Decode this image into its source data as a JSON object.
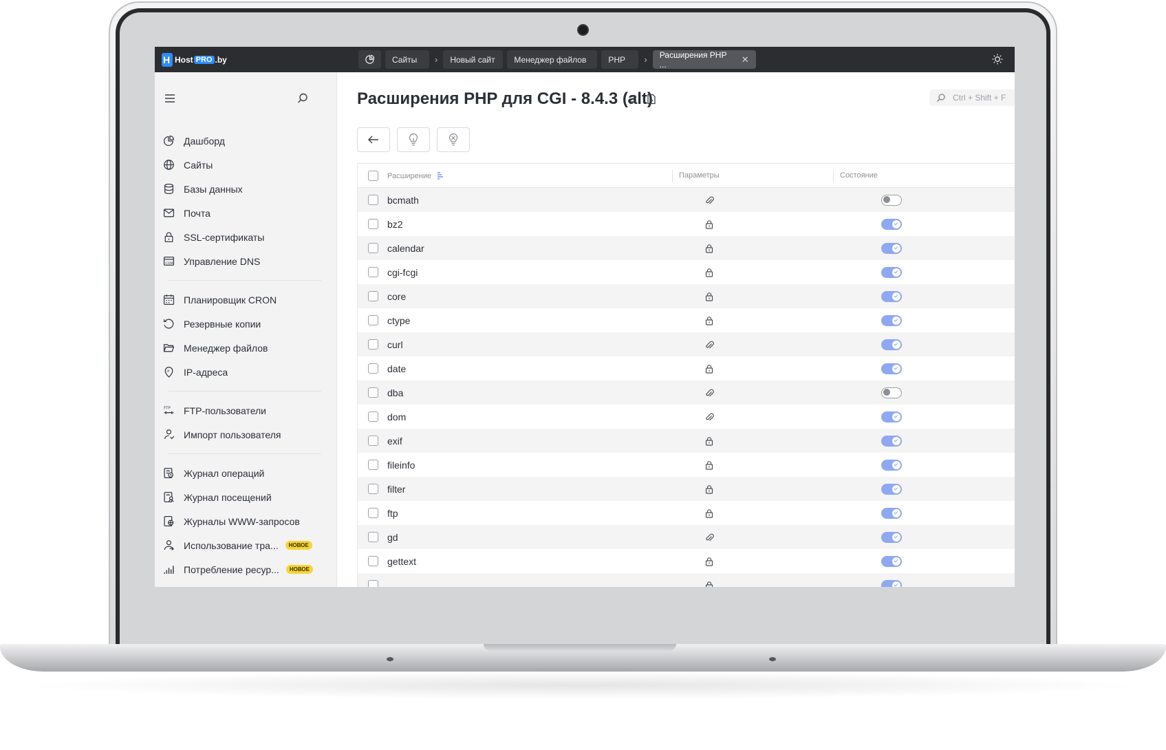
{
  "app": {
    "logo_prefix": "Host",
    "logo_pro": "PRO",
    "logo_suffix": ".by"
  },
  "breadcrumbs": {
    "home_icon": "pie-chart-icon",
    "items": [
      "Сайты",
      "Новый сайт",
      "Менеджер файлов",
      "PHP",
      "Расширения PHP ..."
    ]
  },
  "sidebar": {
    "groups": [
      [
        {
          "label": "Дашборд",
          "icon": "pie-chart-icon"
        },
        {
          "label": "Сайты",
          "icon": "globe-icon"
        },
        {
          "label": "Базы данных",
          "icon": "database-icon"
        },
        {
          "label": "Почта",
          "icon": "mail-icon"
        },
        {
          "label": "SSL-сертификаты",
          "icon": "lock-icon"
        },
        {
          "label": "Управление DNS",
          "icon": "dns-icon"
        }
      ],
      [
        {
          "label": "Планировщик CRON",
          "icon": "calendar-icon"
        },
        {
          "label": "Резервные копии",
          "icon": "backup-icon"
        },
        {
          "label": "Менеджер файлов",
          "icon": "folder-icon"
        },
        {
          "label": "IP-адреса",
          "icon": "ip-pin-icon"
        }
      ],
      [
        {
          "label": "FTP-пользователи",
          "icon": "ftp-icon"
        },
        {
          "label": "Импорт пользователя",
          "icon": "user-import-icon"
        }
      ],
      [
        {
          "label": "Журнал операций",
          "icon": "log-icon"
        },
        {
          "label": "Журнал посещений",
          "icon": "visits-log-icon"
        },
        {
          "label": "Журналы WWW-запросов",
          "icon": "www-log-icon"
        },
        {
          "label": "Использование тра...",
          "icon": "traffic-icon",
          "badge": "НОВОЕ"
        },
        {
          "label": "Потребление ресур...",
          "icon": "bar-chart-icon",
          "badge": "НОВОЕ"
        }
      ]
    ]
  },
  "page": {
    "title": "Расширения PHP для CGI - 8.4.3 (alt)",
    "search_hint": "Ctrl + Shift + F"
  },
  "table": {
    "headers": {
      "name": "Расширение",
      "params": "Параметры",
      "state": "Состояние"
    },
    "rows": [
      {
        "name": "bcmath",
        "param": "clip",
        "enabled": false
      },
      {
        "name": "bz2",
        "param": "lock",
        "enabled": true
      },
      {
        "name": "calendar",
        "param": "lock",
        "enabled": true
      },
      {
        "name": "cgi-fcgi",
        "param": "lock",
        "enabled": true
      },
      {
        "name": "core",
        "param": "lock",
        "enabled": true
      },
      {
        "name": "ctype",
        "param": "lock",
        "enabled": true
      },
      {
        "name": "curl",
        "param": "clip",
        "enabled": true
      },
      {
        "name": "date",
        "param": "lock",
        "enabled": true
      },
      {
        "name": "dba",
        "param": "clip",
        "enabled": false
      },
      {
        "name": "dom",
        "param": "clip",
        "enabled": true
      },
      {
        "name": "exif",
        "param": "lock",
        "enabled": true
      },
      {
        "name": "fileinfo",
        "param": "lock",
        "enabled": true
      },
      {
        "name": "filter",
        "param": "lock",
        "enabled": true
      },
      {
        "name": "ftp",
        "param": "lock",
        "enabled": true
      },
      {
        "name": "gd",
        "param": "clip",
        "enabled": true
      },
      {
        "name": "gettext",
        "param": "lock",
        "enabled": true
      },
      {
        "name": "",
        "param": "lock",
        "enabled": true
      }
    ]
  },
  "colors": {
    "topbar": "#2c2d30",
    "accent_logo": "#2f8df5",
    "toggle_on": "#8fa8f0",
    "badge": "#f6d53a"
  }
}
